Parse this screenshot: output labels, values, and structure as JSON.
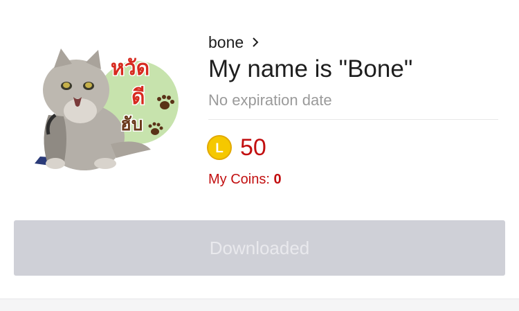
{
  "sticker": {
    "thumbnail_text": [
      "หวัด",
      "ดี",
      "ฮับ"
    ],
    "author": "bone",
    "title": "My name is \"Bone\"",
    "expiry": "No expiration date"
  },
  "price": {
    "coin_glyph": "L",
    "amount": "50",
    "my_coins_label": "My Coins: ",
    "my_coins_count": "0"
  },
  "action": {
    "download_label": "Downloaded"
  },
  "colors": {
    "accent_red": "#c20f10",
    "coin_gold": "#f5c800",
    "button_disabled": "#cfd0d7",
    "sticker_circle": "#c7e3ad"
  }
}
